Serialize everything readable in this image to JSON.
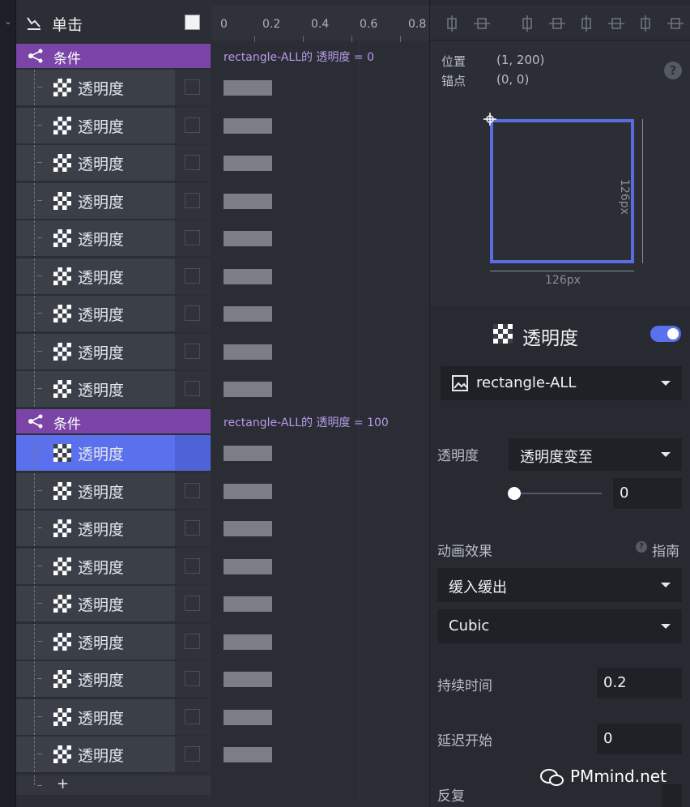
{
  "trigger": {
    "label": "单击"
  },
  "conditions": [
    {
      "label": "条件",
      "expression": "rectangle-ALL的 透明度 = 0"
    },
    {
      "label": "条件",
      "expression": "rectangle-ALL的 透明度 = 100"
    }
  ],
  "group1_actions": [
    "透明度",
    "透明度",
    "透明度",
    "透明度",
    "透明度",
    "透明度",
    "透明度",
    "透明度",
    "透明度"
  ],
  "group2_actions": [
    "透明度",
    "透明度",
    "透明度",
    "透明度",
    "透明度",
    "透明度",
    "透明度",
    "透明度",
    "透明度"
  ],
  "add_label": "+",
  "ruler_ticks": [
    "0",
    "0.2",
    "0.4",
    "0.6",
    "0.8"
  ],
  "preview": {
    "position_label": "位置",
    "position_value": "(1, 200)",
    "anchor_label": "锚点",
    "anchor_value": "(0, 0)",
    "help": "?",
    "width_label": "126px",
    "height_label": "126px"
  },
  "property": {
    "title": "透明度",
    "target": "rectangle-ALL",
    "opacity_label": "透明度",
    "opacity_mode": "透明度变至",
    "opacity_value": "0",
    "slider_fraction": 0,
    "animation_label": "动画效果",
    "guide_label": "指南",
    "easing": "缓入缓出",
    "curve": "Cubic",
    "duration_label": "持续时间",
    "duration_value": "0.2",
    "delay_label": "延迟开始",
    "delay_value": "0",
    "repeat_label": "反复"
  },
  "watermark": "PMmind.net",
  "colors": {
    "accent": "#5b70ec",
    "condition": "#7b45a8",
    "condition_text": "#b89aea"
  }
}
